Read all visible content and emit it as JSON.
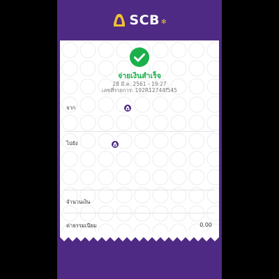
{
  "brand": {
    "name": "SCB",
    "primary_color": "#4e2a84",
    "logo_color": "#f2c230"
  },
  "receipt": {
    "status_icon": "check-circle-icon",
    "status_text": "จ่ายเงินสำเร็จ",
    "status_color": "#1bb04b",
    "date_time": "28 มี.ค. 2561 - 19:27",
    "reference": "เลขที่รายการ: 192R12744f545"
  },
  "rows": {
    "from_label": "จาก",
    "to_label": "ไปยัง",
    "amount_label": "จำนวนเงิน",
    "fee_label": "ค่าธรรมเนียม",
    "fee_value": "0.00"
  }
}
